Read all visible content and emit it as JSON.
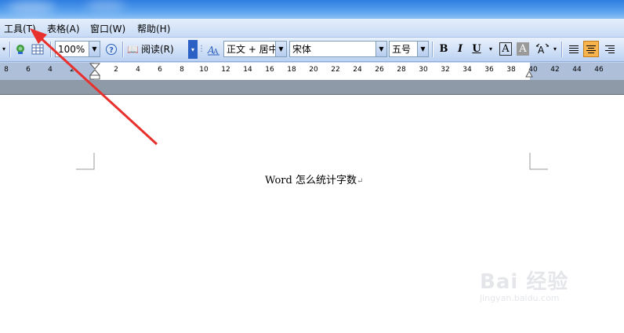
{
  "menu": {
    "items": [
      {
        "label": "工具(T)"
      },
      {
        "label": "表格(A)"
      },
      {
        "label": "窗口(W)"
      },
      {
        "label": "帮助(H)"
      }
    ]
  },
  "toolbar": {
    "zoom": "100%",
    "read_label": "阅读(R)",
    "style_value": "正文 + 居中",
    "font_value": "宋体",
    "size_value": "五号",
    "bold": "B",
    "italic": "I",
    "underline": "U",
    "font_color": "A",
    "char_shading": "A"
  },
  "ruler": {
    "labels": [
      "8",
      "6",
      "4",
      "2",
      "2",
      "4",
      "6",
      "8",
      "10",
      "12",
      "14",
      "16",
      "18",
      "20",
      "22",
      "24",
      "26",
      "28",
      "30",
      "32",
      "34",
      "36",
      "38",
      "40",
      "42",
      "44",
      "46"
    ]
  },
  "document": {
    "text": "Word 怎么统计字数",
    "paragraph_mark": "↵"
  },
  "watermark": {
    "brand": "Bai 经验",
    "url": "jingyan.baidu.com"
  },
  "colors": {
    "accent_arrow": "#e8302c",
    "menubar": "#c8dbf5",
    "active_button": "#f7b44c"
  }
}
